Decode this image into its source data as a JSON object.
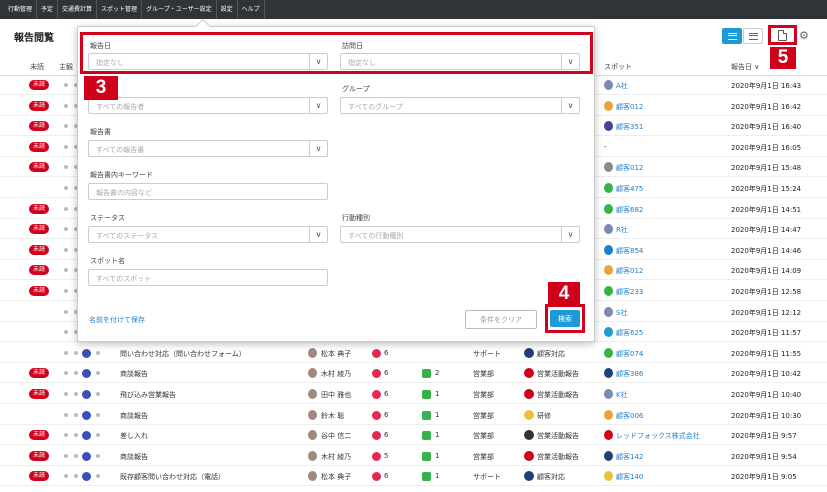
{
  "nav": [
    "行動管理",
    "予定",
    "交通費計算",
    "スポット管理",
    "グループ・ユーザー設定",
    "設定",
    "ヘルプ"
  ],
  "page_title": "報告閲覧",
  "columns": {
    "unread": "未読",
    "main": "主観",
    "spot": "スポット",
    "report_date": "報告日"
  },
  "sort_arrow": "∨",
  "callouts": {
    "n3": "3",
    "n4": "4",
    "n5": "5"
  },
  "filter": {
    "report_date_label": "報告日",
    "report_date_value": "指定なし",
    "visit_date_label": "訪問日",
    "visit_date_value": "指定なし",
    "reporter_placeholder": "すべての報告者",
    "group_label": "グループ",
    "group_value": "すべてのグループ",
    "report_form_label": "報告書",
    "report_form_value": "すべての報告書",
    "keyword_label": "報告書内キーワード",
    "keyword_placeholder": "報告書の内容など",
    "status_label": "ステータス",
    "status_value": "すべてのステータス",
    "action_type_label": "行動種別",
    "action_type_value": "すべての行動種別",
    "spot_label": "スポット名",
    "spot_placeholder": "すべてのスポット",
    "save_link": "名前を付けて保存",
    "clear_button": "条件をクリア",
    "search_button": "検索"
  },
  "rows": [
    {
      "unread": "未読",
      "spot": "A社",
      "date": "2020年9月1日 16:43",
      "spot_color": "#7a8ab0"
    },
    {
      "unread": "未読",
      "spot": "顧客012",
      "date": "2020年9月1日 16:42",
      "spot_color": "#e8a33a"
    },
    {
      "unread": "未読",
      "spot": "顧客351",
      "date": "2020年9月1日 16:40",
      "spot_color": "#4a3f99"
    },
    {
      "unread": "未読",
      "spot": "-",
      "date": "2020年9月1日 16:05",
      "spot_color": ""
    },
    {
      "unread": "未読",
      "spot": "顧客012",
      "date": "2020年9月1日 15:48",
      "spot_color": "#8a8a8a"
    },
    {
      "unread": "",
      "spot": "顧客475",
      "date": "2020年9月1日 15:24",
      "spot_color": "#35b34a"
    },
    {
      "unread": "未読",
      "spot": "顧客682",
      "date": "2020年9月1日 14:51",
      "spot_color": "#35b34a"
    },
    {
      "unread": "未読",
      "spot": "R社",
      "date": "2020年9月1日 14:47",
      "spot_color": "#7a8ab0"
    },
    {
      "unread": "未読",
      "spot": "顧客854",
      "date": "2020年9月1日 14:46",
      "spot_color": "#1e7fd0"
    },
    {
      "unread": "未読",
      "spot": "顧客012",
      "date": "2020年9月1日 14:09",
      "spot_color": "#e8a33a"
    },
    {
      "unread": "未読",
      "spot": "顧客233",
      "date": "2020年9月1日 12:58",
      "spot_color": "#35b34a"
    },
    {
      "unread": "",
      "spot": "S社",
      "date": "2020年9月1日 12:12",
      "spot_color": "#7a8ab0"
    },
    {
      "unread": "",
      "spot": "顧客625",
      "date": "2020年9月1日 11:57",
      "spot_color": "#1e9bd7"
    },
    {
      "unread": "",
      "title": "問い合わせ対応（問い合わせフォーム）",
      "person": "松本 典子",
      "likes": "6",
      "comments": "",
      "dept": "サポート",
      "type": "顧客対応",
      "spot": "顧客074",
      "date": "2020年9月1日 11:55",
      "spot_color": "#35b34a",
      "type_color": "#1e3f7a"
    },
    {
      "unread": "未読",
      "title": "商談報告",
      "person": "木村 綾乃",
      "likes": "6",
      "comments": "2",
      "dept": "営業部",
      "type": "営業活動報告",
      "spot": "顧客386",
      "date": "2020年9月1日 10:42",
      "spot_color": "#1e3f7a",
      "type_color": "#d0021b"
    },
    {
      "unread": "未読",
      "title": "飛び込み営業報告",
      "person": "田中 雅也",
      "likes": "6",
      "comments": "1",
      "dept": "営業部",
      "type": "営業活動報告",
      "spot": "K社",
      "date": "2020年9月1日 10:40",
      "spot_color": "#7a8ab0",
      "type_color": "#d0021b"
    },
    {
      "unread": "",
      "title": "商談報告",
      "person": "鈴木 聡",
      "likes": "6",
      "comments": "1",
      "dept": "営業部",
      "type": "研修",
      "spot": "顧客006",
      "date": "2020年9月1日 10:30",
      "spot_color": "#e8a33a",
      "type_color": "#e8c33a"
    },
    {
      "unread": "未読",
      "title": "差し入れ",
      "person": "谷中 信二",
      "likes": "6",
      "comments": "1",
      "dept": "営業部",
      "type": "営業活動報告",
      "spot": "レッドフォックス株式会社",
      "date": "2020年9月1日 9:57",
      "spot_color": "#d0021b",
      "type_color": "#333"
    },
    {
      "unread": "未読",
      "title": "商談報告",
      "person": "木村 綾乃",
      "likes": "5",
      "comments": "1",
      "dept": "営業部",
      "type": "営業活動報告",
      "spot": "顧客142",
      "date": "2020年9月1日 9:54",
      "spot_color": "#1e3f7a",
      "type_color": "#d0021b"
    },
    {
      "unread": "未読",
      "title": "既存顧客問い合わせ対応（電話）",
      "person": "松本 典子",
      "likes": "6",
      "comments": "1",
      "dept": "サポート",
      "type": "顧客対応",
      "spot": "顧客140",
      "date": "2020年9月1日 9:05",
      "spot_color": "#e8c33a",
      "type_color": "#1e3f7a"
    }
  ]
}
